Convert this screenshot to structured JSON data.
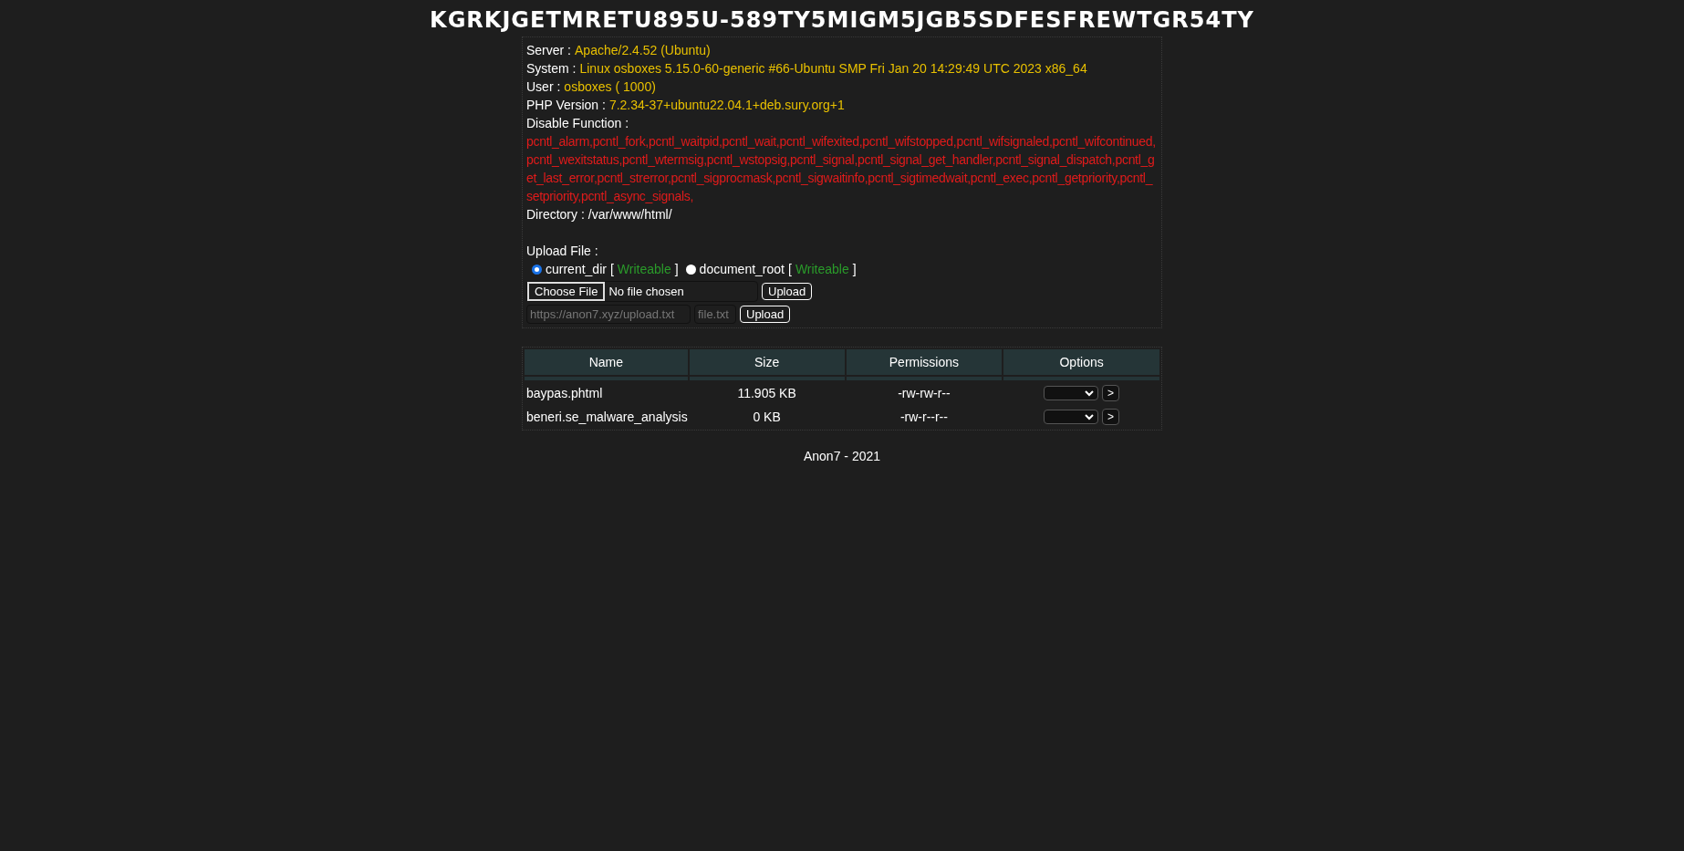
{
  "title": "KGRKJGETMRETU895U-589TY5MIGM5JGB5SDFESFREWTGR54TY",
  "info": [
    {
      "label": "Server :",
      "value": "Apache/2.4.52 (Ubuntu)"
    },
    {
      "label": "System :",
      "value": "Linux osboxes 5.15.0-60-generic #66-Ubuntu SMP Fri Jan 20 14:29:49 UTC 2023 x86_64"
    },
    {
      "label": "User :",
      "value": "osboxes",
      "extra": "( 1000)"
    },
    {
      "label": "PHP Version :",
      "value": "7.2.34-37+ubuntu22.04.1+deb.sury.org+1"
    }
  ],
  "disable_function": {
    "label": "Disable Function :",
    "value": "pcntl_alarm,pcntl_fork,pcntl_waitpid,pcntl_wait,pcntl_wifexited,pcntl_wifstopped,pcntl_wifsignaled,pcntl_wifcontinued,pcntl_wexitstatus,pcntl_wtermsig,pcntl_wstopsig,pcntl_signal,pcntl_signal_get_handler,pcntl_signal_dispatch,pcntl_get_last_error,pcntl_strerror,pcntl_sigprocmask,pcntl_sigwaitinfo,pcntl_sigtimedwait,pcntl_exec,pcntl_getpriority,pcntl_setpriority,pcntl_async_signals,"
  },
  "directory": {
    "label": "Directory :",
    "value": "/var/www/html/"
  },
  "upload": {
    "label": "Upload File :",
    "targets": [
      {
        "label": "current_dir",
        "open": "[",
        "status": "Writeable",
        "close": "]",
        "selected": true
      },
      {
        "label": "document_root",
        "open": "[",
        "status": "Writeable",
        "close": "]",
        "selected": false
      }
    ],
    "choose_button": "Choose File",
    "file_status": "No file chosen",
    "upload_button": "Upload",
    "url_placeholder": "https://anon7.xyz/upload.txt",
    "name_placeholder": "file.txt",
    "url_upload_button": "Upload"
  },
  "table": {
    "columns": [
      "Name",
      "Size",
      "Permissions",
      "Options"
    ],
    "rows": [
      {
        "name": "baypas.phtml",
        "size": "11.905 KB",
        "permissions": "-rw-rw-r--",
        "go": ">"
      },
      {
        "name": "beneri.se_malware_analysis",
        "size": "0 KB",
        "permissions": "-rw-r--r--",
        "go": ">"
      }
    ]
  },
  "footer": "Anon7 - 2021"
}
